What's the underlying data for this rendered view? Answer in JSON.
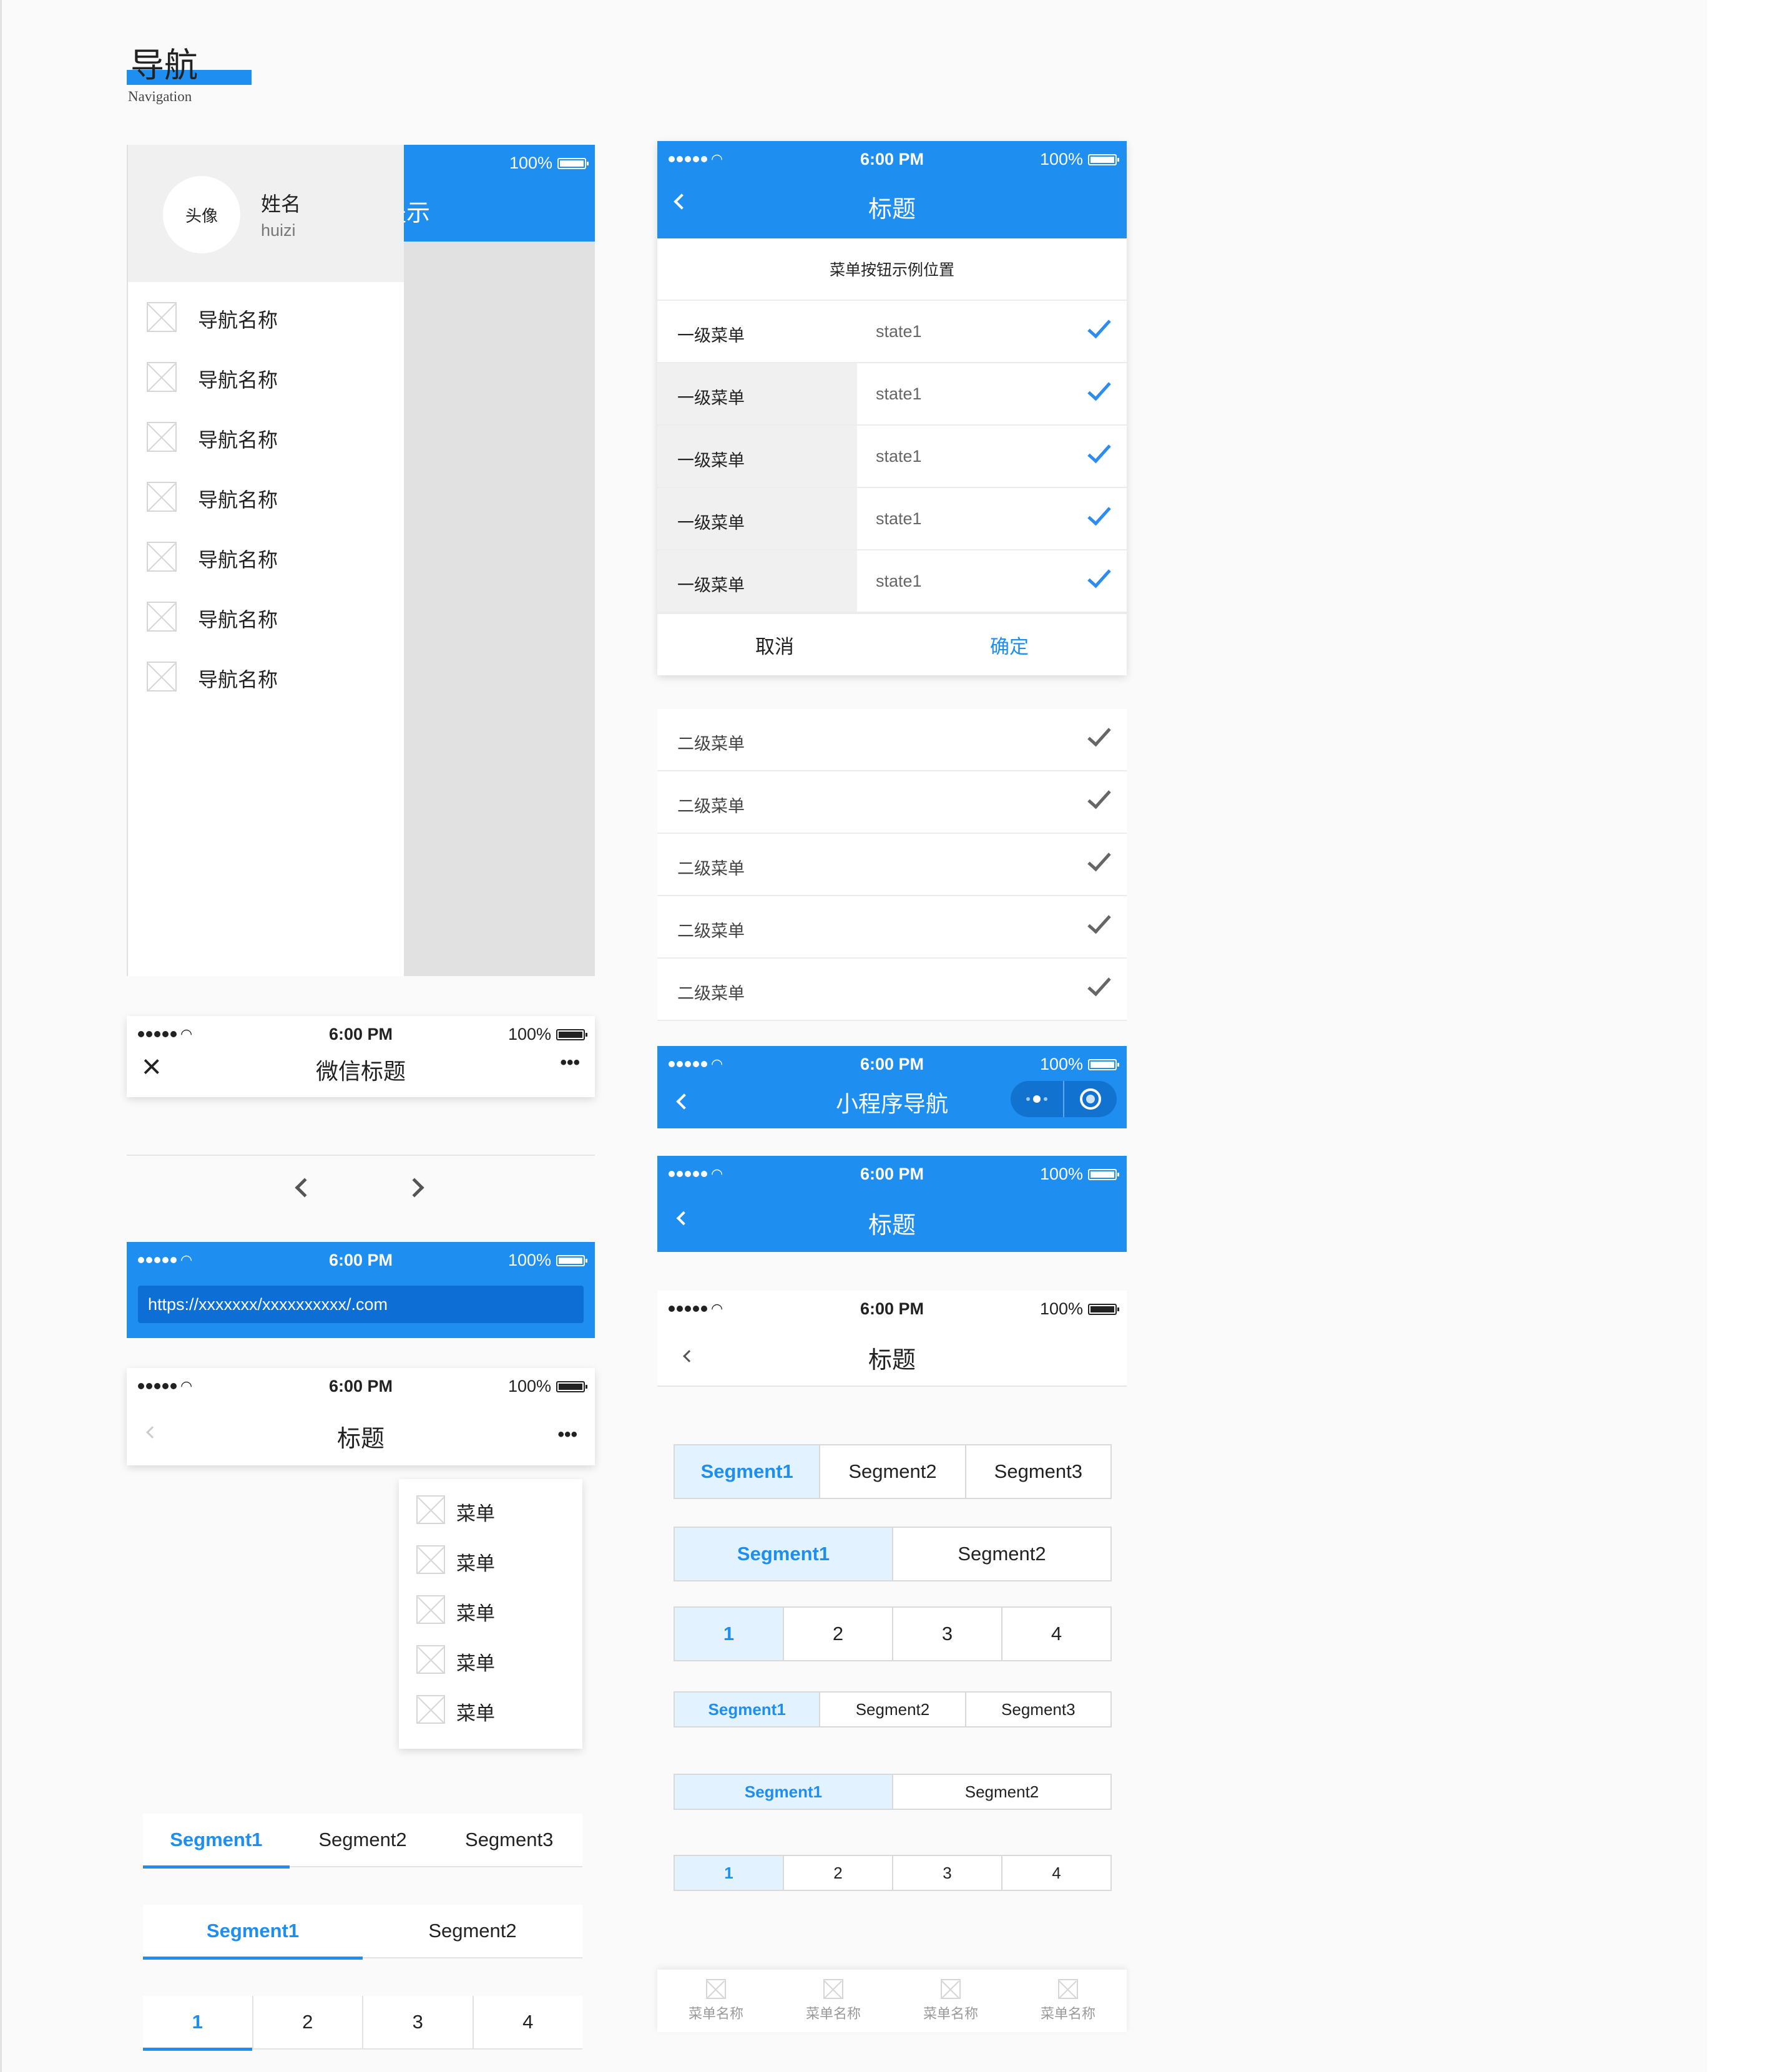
{
  "section": {
    "title": "导航",
    "subtitle": "Navigation"
  },
  "status": {
    "time": "6:00 PM",
    "battery": "100%"
  },
  "drawer": {
    "avatar": "头像",
    "name": "姓名",
    "username": "huizi",
    "behind_title": "提示",
    "items": [
      "导航名称",
      "导航名称",
      "导航名称",
      "导航名称",
      "导航名称",
      "导航名称",
      "导航名称"
    ]
  },
  "picker": {
    "title": "标题",
    "hint": "菜单按钮示例位置",
    "rows": [
      {
        "menu": "一级菜单",
        "state": "state1"
      },
      {
        "menu": "一级菜单",
        "state": "state1"
      },
      {
        "menu": "一级菜单",
        "state": "state1"
      },
      {
        "menu": "一级菜单",
        "state": "state1"
      },
      {
        "menu": "一级菜单",
        "state": "state1"
      }
    ],
    "cancel": "取消",
    "confirm": "确定"
  },
  "secondary_list": [
    "二级菜单",
    "二级菜单",
    "二级菜单",
    "二级菜单",
    "二级菜单"
  ],
  "wechat": {
    "title": "微信标题",
    "more": "•••"
  },
  "browser": {
    "url": "https://xxxxxxx/xxxxxxxxxx/.com"
  },
  "menu_bar": {
    "title": "标题",
    "more": "•••",
    "items": [
      "菜单",
      "菜单",
      "菜单",
      "菜单",
      "菜单"
    ]
  },
  "miniprogram": {
    "title": "小程序导航"
  },
  "blue_nav": {
    "title": "标题"
  },
  "white_nav": {
    "title": "标题"
  },
  "segments": {
    "three": [
      "Segment1",
      "Segment2",
      "Segment3"
    ],
    "two": [
      "Segment1",
      "Segment2"
    ],
    "four": [
      "1",
      "2",
      "3",
      "4"
    ]
  },
  "tabbar": [
    "菜单名称",
    "菜单名称",
    "菜单名称",
    "菜单名称"
  ],
  "colors": {
    "primary": "#1e8ef0",
    "selected_bg": "#e3f2ff"
  }
}
